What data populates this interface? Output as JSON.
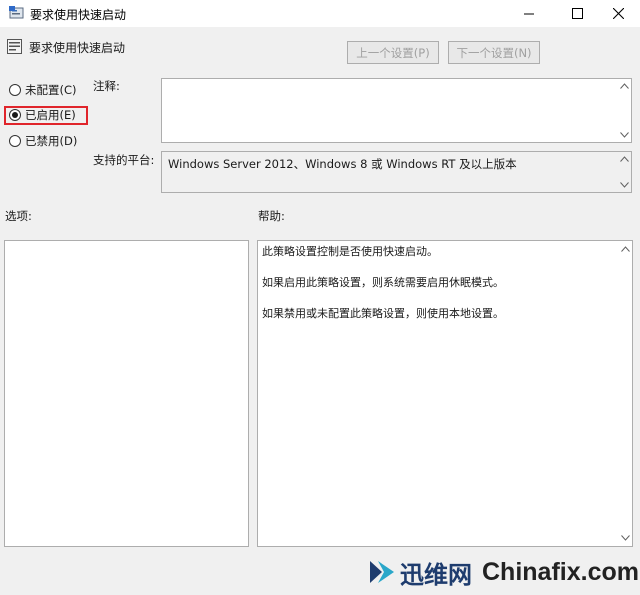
{
  "window": {
    "title": "要求使用快速启动"
  },
  "header": {
    "title": "要求使用快速启动",
    "prev_button": "上一个设置(P)",
    "next_button": "下一个设置(N)"
  },
  "state_options": [
    {
      "label": "未配置(C)",
      "checked": false
    },
    {
      "label": "已启用(E)",
      "checked": true
    },
    {
      "label": "已禁用(D)",
      "checked": false
    }
  ],
  "comment": {
    "label": "注释:",
    "value": ""
  },
  "supported": {
    "label": "支持的平台:",
    "value": "Windows Server 2012、Windows 8 或 Windows RT 及以上版本"
  },
  "options_section": {
    "label": "选项:"
  },
  "help_section": {
    "label": "帮助:",
    "paragraphs": [
      "此策略设置控制是否使用快速启动。",
      "如果启用此策略设置，则系统需要启用休眠模式。",
      "如果禁用或未配置此策略设置，则使用本地设置。"
    ]
  },
  "watermark": {
    "cn_text": "迅维网",
    "en_text": "Chinafix.com"
  },
  "colors": {
    "highlight": "#e0252b",
    "background": "#f0f0f0"
  }
}
